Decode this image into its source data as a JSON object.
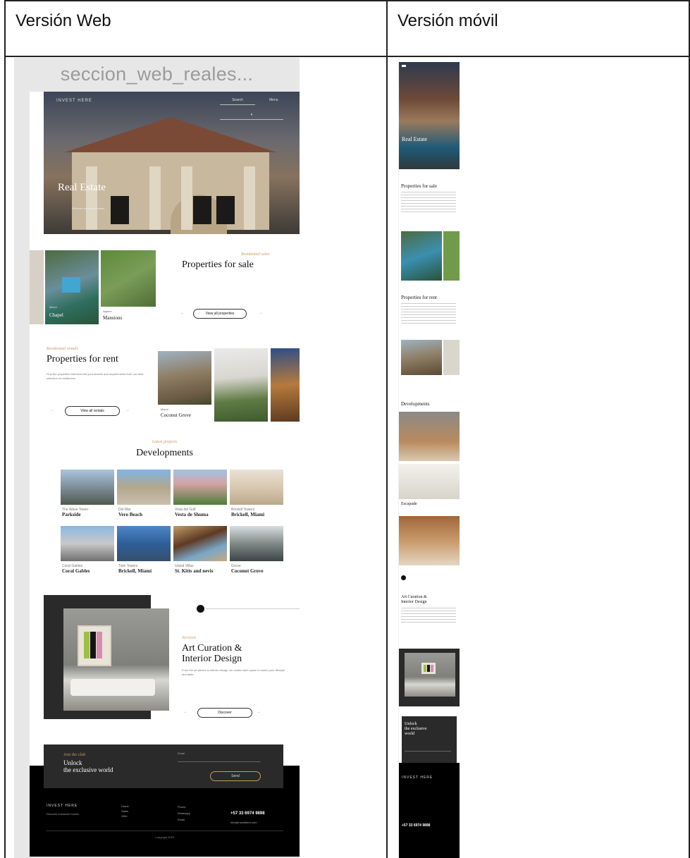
{
  "table": {
    "web_header": "Versión Web",
    "mobile_header": "Versión móvil"
  },
  "web": {
    "frame_title": "seccion_web_reales...",
    "hero": {
      "logo": "INVEST HERE",
      "nav1": "Search",
      "nav2": "Menu",
      "title": "Real Estate",
      "subtitle": "Discover exclusive homes"
    },
    "sale": {
      "eyebrow": "Residential sales",
      "title": "Properties for sale",
      "card1_label": "Miami",
      "card1_city": "Chapel",
      "card2_label": "Naples",
      "card2_city": "Mansions",
      "button": "View all properties"
    },
    "rent": {
      "eyebrow": "Residential rentals",
      "title": "Properties for rent",
      "text": "Find the properties that best suit your desires and requirements from our wide selection of residences.",
      "button": "View all rentals",
      "card_label": "Miami",
      "card_city": "Coconut Grove"
    },
    "dev": {
      "eyebrow": "Latest projects",
      "title": "Developments",
      "items": [
        {
          "small": "The Wave Tower",
          "name": "Parkside"
        },
        {
          "small": "Del Mar",
          "name": "Vero Beach"
        },
        {
          "small": "Vista del Golf",
          "name": "Vesta de Shuma"
        },
        {
          "small": "Brickell Towers",
          "name": "Brickell, Miami"
        },
        {
          "small": "Coral Gables",
          "name": "Coral Gables"
        },
        {
          "small": "Twin Towers",
          "name": "Brickell, Miami"
        },
        {
          "small": "Island Villas",
          "name": "St. Kitts and nevis"
        },
        {
          "small": "Grove",
          "name": "Coconut Grove"
        }
      ]
    },
    "art": {
      "eyebrow": "Services",
      "title_line1": "Art Curation &",
      "title_line2": "Interior Design",
      "text": "From the art pieces to interior design, we curate each space to match your lifestyle and taste.",
      "button": "Discover"
    },
    "newsletter": {
      "eyebrow": "Join the club",
      "title_line1": "Unlock",
      "title_line2": "the exclusive world",
      "field_label": "Email",
      "button": "Send"
    },
    "footer": {
      "logo": "INVEST HERE",
      "tagline": "Discover exclusive homes",
      "col1": [
        "Home",
        "Sales",
        "Offer"
      ],
      "col2": [
        "Phone",
        "Whatsapp",
        "Email"
      ],
      "phone": "+57 33 6974 9898",
      "email": "info@investhere.com",
      "copyright": "Copyright 2023"
    }
  },
  "mobile": {
    "hero_title": "Real Estate",
    "sale_title": "Properties for sale",
    "rent_title": "Properties for rent",
    "dev_title": "Developments",
    "dev_card": "Escapade",
    "art_line1": "Art Curation &",
    "art_line2": "Interior Design",
    "nl_line1": "Unlock",
    "nl_line2": "the exclusive",
    "nl_line3": "world",
    "footer_logo": "INVEST HERE",
    "footer_phone": "+57 33 6974 9898"
  },
  "colors": {
    "accent": "#c79a5a",
    "dark": "#2a2a2a",
    "footer": "#000000"
  }
}
